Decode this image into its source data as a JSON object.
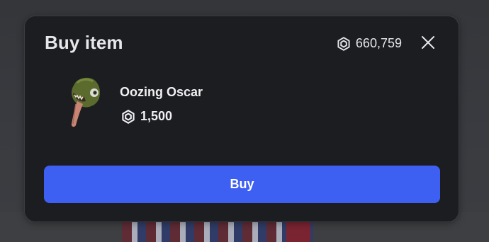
{
  "modal": {
    "title": "Buy item",
    "balance": "660,759",
    "currency_icon": "robux-icon",
    "close_icon": "close-icon"
  },
  "item": {
    "name": "Oozing Oscar",
    "price": "1,500",
    "thumbnail_icon": "oozing-oscar-thumbnail"
  },
  "actions": {
    "buy_label": "Buy"
  },
  "colors": {
    "modal_bg": "#1c1d21",
    "accent": "#3e60f2",
    "text": "#e7e7ea"
  }
}
